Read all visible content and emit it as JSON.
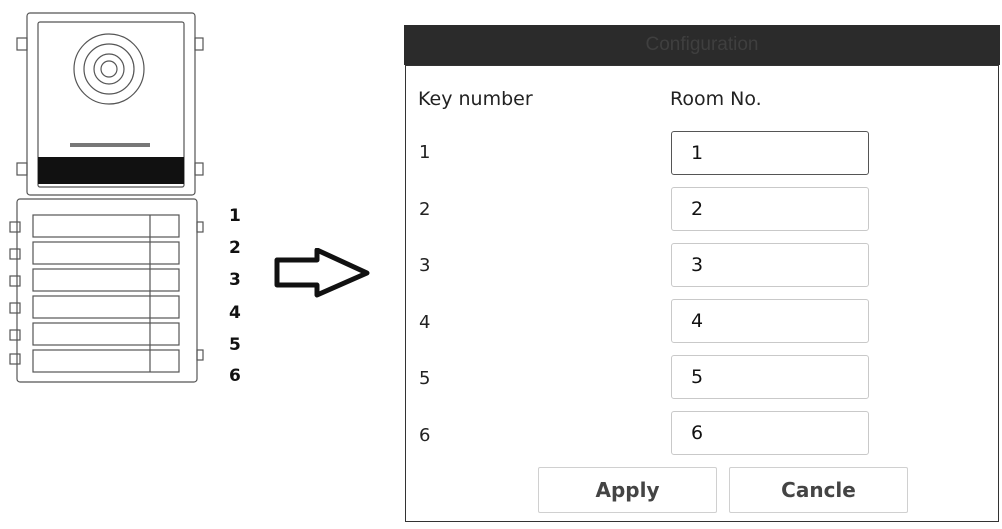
{
  "device": {
    "key_numbers": [
      "1",
      "2",
      "3",
      "4",
      "5",
      "6"
    ]
  },
  "dialog": {
    "title": "Configuration",
    "header_key": "Key number",
    "header_room": "Room No.",
    "rows": [
      {
        "key": "1",
        "room": "1"
      },
      {
        "key": "2",
        "room": "2"
      },
      {
        "key": "3",
        "room": "3"
      },
      {
        "key": "4",
        "room": "4"
      },
      {
        "key": "5",
        "room": "5"
      },
      {
        "key": "6",
        "room": "6"
      }
    ],
    "apply_label": "Apply",
    "cancel_label": "Cancle"
  },
  "colors": {
    "titlebar": "#2b2b2b",
    "border": "#c9c9c9"
  }
}
